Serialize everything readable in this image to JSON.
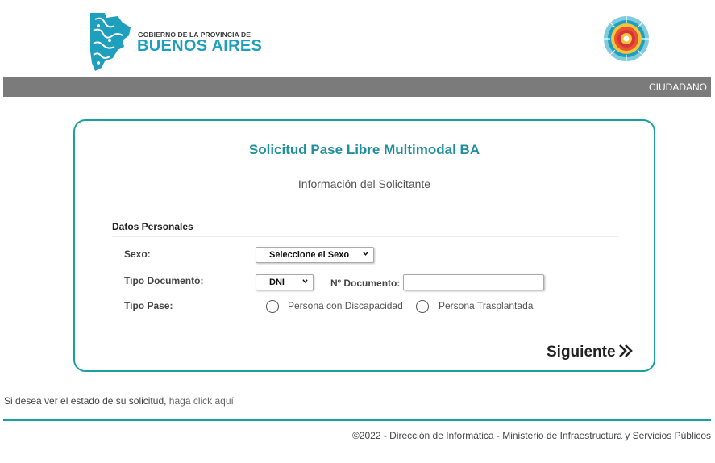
{
  "header": {
    "gov_line": "GOBIERNO DE LA PROVINCIA DE",
    "province_name": "BUENOS AIRES",
    "user_role": "CIUDADANO"
  },
  "form": {
    "title": "Solicitud Pase Libre Multimodal BA",
    "subtitle": "Información del Solicitante",
    "section_title": "Datos Personales",
    "sexo_label": "Sexo:",
    "sexo_value": "Seleccione el Sexo",
    "tipo_documento_label": "Tipo Documento:",
    "tipo_documento_value": "DNI",
    "nro_documento_label": "Nº Documento:",
    "nro_documento_value": "",
    "tipo_pase_label": "Tipo Pase:",
    "tipo_pase_options": [
      "Persona con Discapacidad",
      "Persona Trasplantada"
    ],
    "next_label": "Siguiente"
  },
  "status": {
    "text": "Si desea ver el estado de su solicitud, ",
    "link": "haga click aquí"
  },
  "footer": {
    "text": "©2022 - Dirección de Informática - Ministerio de Infraestructura y Servicios Públicos"
  },
  "colors": {
    "accent": "#19a1a0",
    "title": "#1e8f9f",
    "topbar": "#7b7b7b",
    "brand_blue": "#1e9fbd"
  }
}
